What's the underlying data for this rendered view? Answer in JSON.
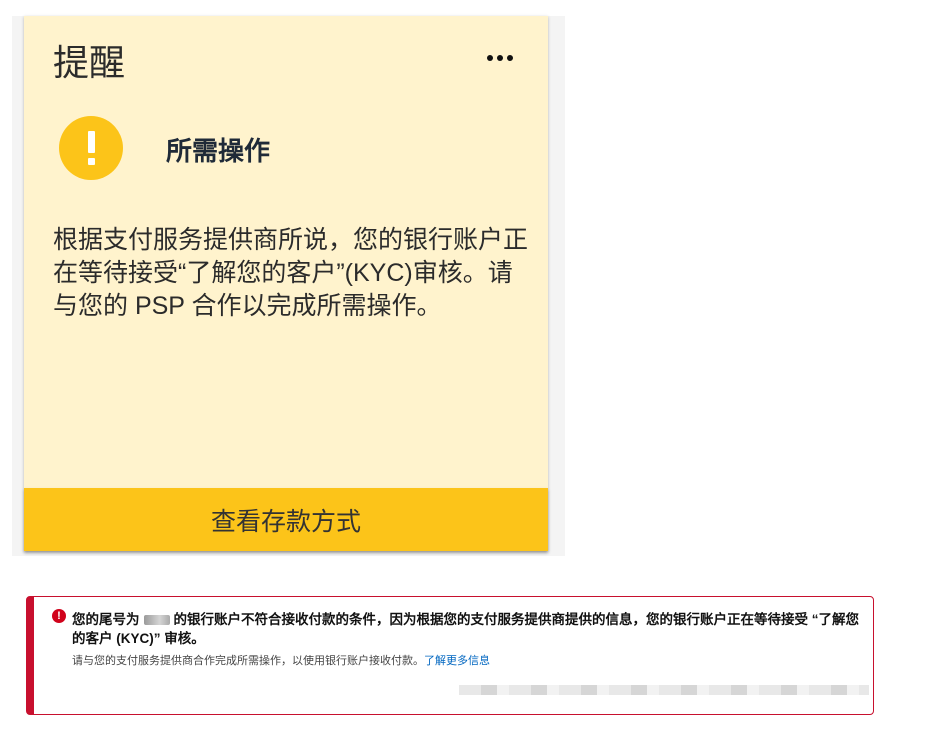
{
  "card": {
    "title": "提醒",
    "more_menu": "more-horizontal-icon",
    "status_icon": "warning-icon",
    "action_label": "所需操作",
    "body": "根据支付服务提供商所说，您的银行账户正在等待接受“了解您的客户”(KYC)审核。请与您的 PSP 合作以完成所需操作。",
    "button_label": "查看存款方式",
    "accent_color": "#fcc419",
    "background_color": "#fff3cd"
  },
  "alert": {
    "icon": "error-icon",
    "main_prefix": "您的尾号为",
    "main_suffix": "的银行账户不符合接收付款的条件，因为根据您的支付服务提供商提供的信息，您的银行账户正在等待接受 “了解您的客户 (KYC)” 审核。",
    "sub_text": "请与您的支付服务提供商合作完成所需操作，以使用银行账户接收付款。",
    "link_text": "了解更多信息",
    "border_color": "#c8102e"
  }
}
